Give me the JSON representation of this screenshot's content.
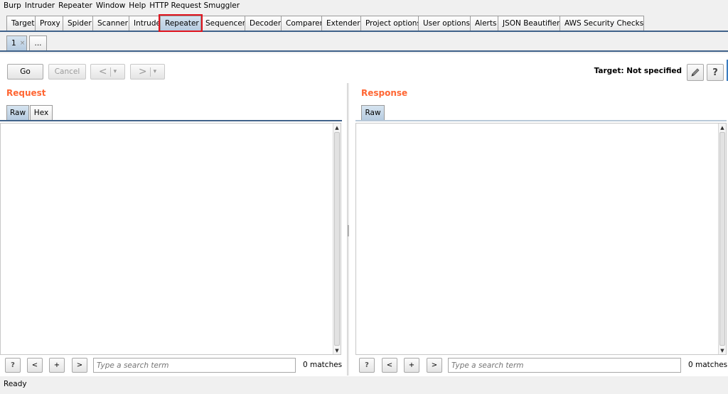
{
  "menu": [
    "Burp",
    "Intruder",
    "Repeater",
    "Window",
    "Help",
    "HTTP Request Smuggler"
  ],
  "main_tabs": [
    "Target",
    "Proxy",
    "Spider",
    "Scanner",
    "Intruder",
    "Repeater",
    "Sequencer",
    "Decoder",
    "Comparer",
    "Extender",
    "Project options",
    "User options",
    "Alerts",
    "JSON Beautifier",
    "AWS Security Checks"
  ],
  "active_main_tab": "Repeater",
  "sub_tabs": {
    "current": "1",
    "close": "×",
    "more": "..."
  },
  "toolbar": {
    "go": "Go",
    "cancel": "Cancel",
    "back": "<",
    "forward": ">",
    "dropdown": "▾",
    "target": "Target: Not specified",
    "edit_icon": "pencil-icon",
    "help": "?"
  },
  "request": {
    "title": "Request",
    "tabs": [
      "Raw",
      "Hex"
    ]
  },
  "response": {
    "title": "Response",
    "tabs": [
      "Raw"
    ]
  },
  "search": {
    "help": "?",
    "prev": "<",
    "add": "+",
    "next": ">",
    "placeholder": "Type a search term",
    "matches": "0 matches"
  },
  "status": "Ready",
  "colors": {
    "accent_title": "#ff6633",
    "tab_line": "#40628a",
    "highlight_outline": "#e0141e"
  }
}
